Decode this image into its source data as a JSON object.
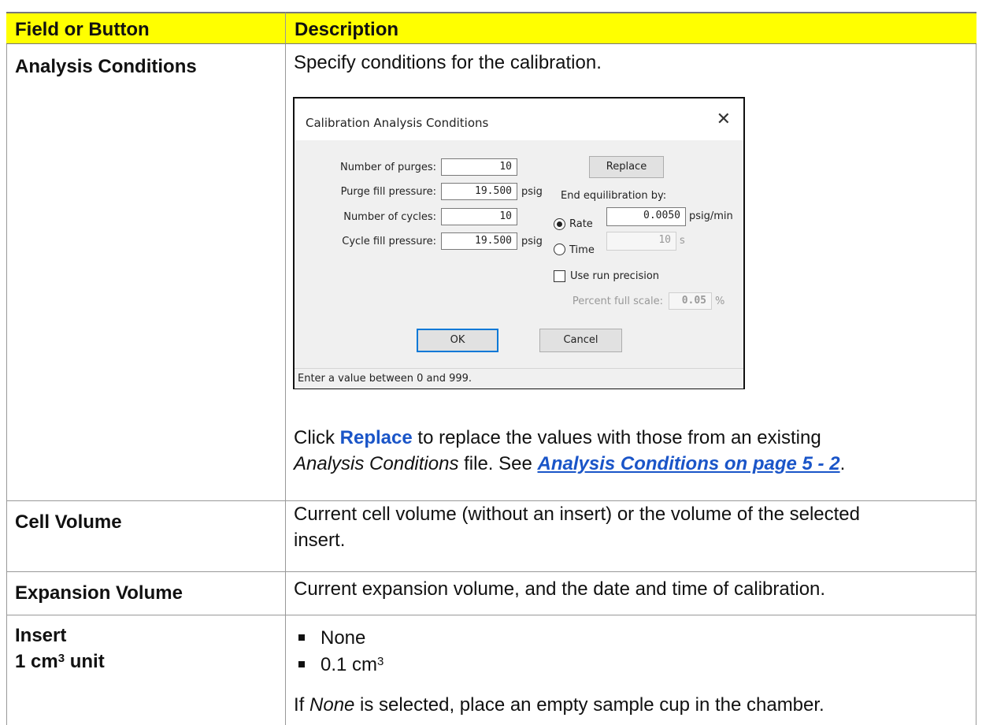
{
  "table": {
    "header": {
      "col1": "Field or Button",
      "col2": "Description"
    },
    "rows": [
      {
        "field": "Analysis Conditions",
        "description": "Specify conditions for the calibration.",
        "after_dialog_line1_pre": "Click ",
        "after_dialog_line1_bold": "Replace",
        "after_dialog_line1_post": " to replace the values with those from an existing",
        "after_dialog_line2_italic": "Analysis Conditions",
        "after_dialog_line2_mid": " file. See ",
        "after_dialog_line2_link": "Analysis Conditions on page 5 - 2",
        "after_dialog_line2_end": "."
      },
      {
        "field": "Cell Volume",
        "description_line1": "Current cell volume (without an insert) or the volume of the selected",
        "description_line2": "insert."
      },
      {
        "field": "Expansion Volume",
        "description": "Current expansion volume, and the date and time of calibration."
      },
      {
        "field_line1": "Insert",
        "field_line2_pre": "1 cm",
        "field_line2_sup": "3",
        "field_line2_post": " unit",
        "bullets": [
          {
            "text": "None",
            "sup": ""
          },
          {
            "text": "0.1 cm",
            "sup": "3"
          }
        ],
        "note_italic": "None",
        "note_rest": " is selected, place an empty sample cup in the chamber.",
        "note_pre": "If "
      }
    ]
  },
  "dialog": {
    "title": "Calibration Analysis Conditions",
    "close_glyph": "✕",
    "fields": {
      "purges_label": "Number of purges:",
      "purges_value": "10",
      "purge_fill_label": "Purge fill pressure:",
      "purge_fill_value": "19.500",
      "purge_fill_unit": "psig",
      "cycles_label": "Number of cycles:",
      "cycles_value": "10",
      "cycle_fill_label": "Cycle fill pressure:",
      "cycle_fill_value": "19.500",
      "cycle_fill_unit": "psig"
    },
    "replace_button": "Replace",
    "end_equil_label": "End equilibration by:",
    "rate_label": "Rate",
    "rate_value": "0.0050",
    "rate_unit": "psig/min",
    "rate_selected": true,
    "time_label": "Time",
    "time_value": "10",
    "time_unit": "s",
    "use_run_precision_label": "Use run precision",
    "use_run_precision_checked": false,
    "percent_label": "Percent full scale:",
    "percent_value": "0.05",
    "percent_unit": "%",
    "ok_button": "OK",
    "cancel_button": "Cancel",
    "status_text": "Enter a value between 0 and 999."
  },
  "colors": {
    "header_bg": "#ffff00",
    "link": "#1a55c8",
    "default_button_border": "#0078d7"
  }
}
